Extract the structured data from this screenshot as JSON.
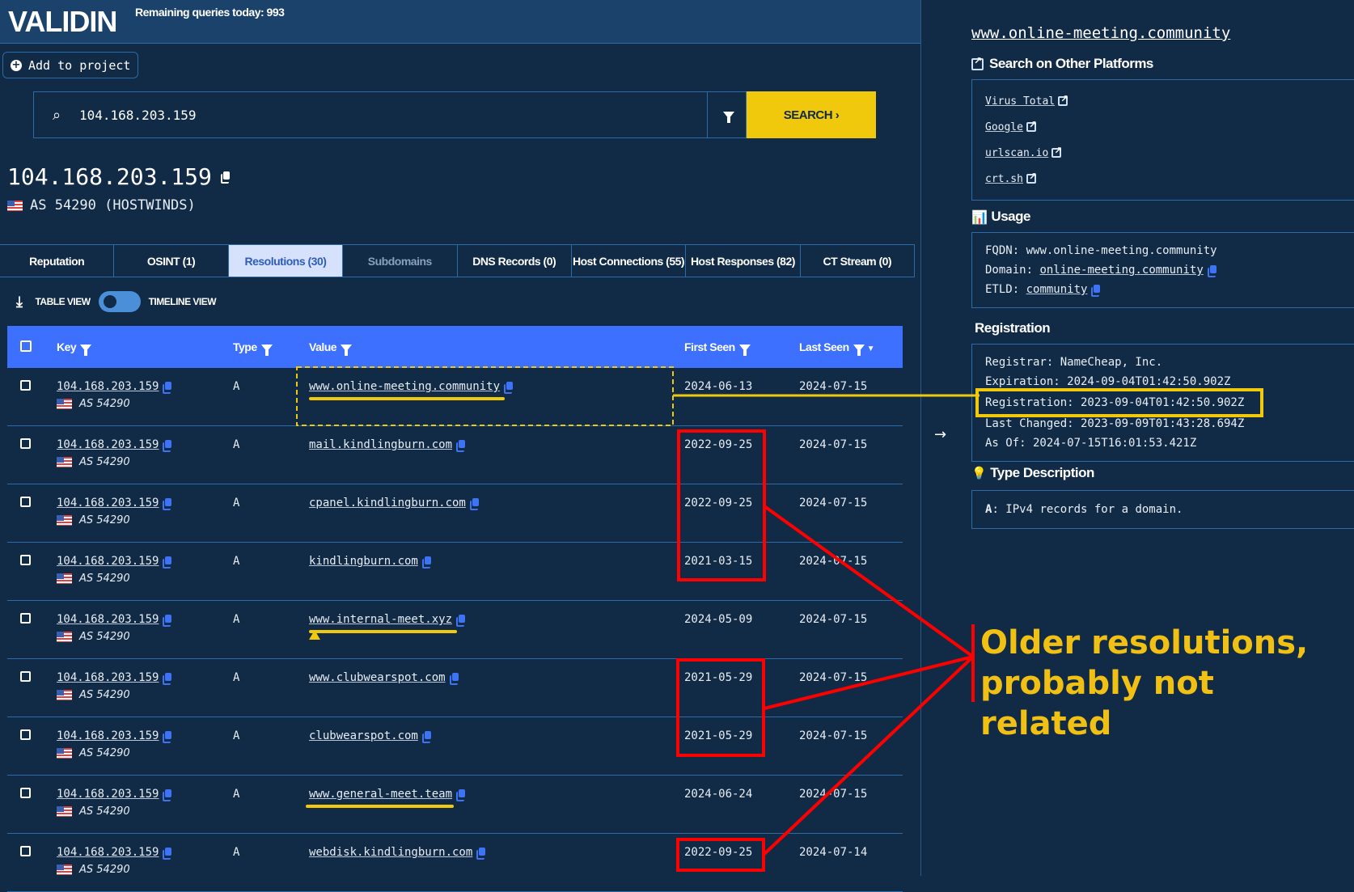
{
  "header": {
    "logo": "VALIDIN",
    "remaining": "Remaining queries today: 993"
  },
  "actions": {
    "add_to_project": "Add to project"
  },
  "search": {
    "value": "104.168.203.159",
    "placeholder": "",
    "button": "SEARCH ›"
  },
  "subject": {
    "ip": "104.168.203.159",
    "asn": "AS 54290 (HOSTWINDS)"
  },
  "tabs": [
    {
      "label": "Reputation"
    },
    {
      "label": "OSINT (1)"
    },
    {
      "label": "Resolutions (30)"
    },
    {
      "label": "Subdomains"
    },
    {
      "label": "DNS Records (0)"
    },
    {
      "label": "Host Connections (55)"
    },
    {
      "label": "Host Responses (82)"
    },
    {
      "label": "CT Stream (0)"
    }
  ],
  "view": {
    "table": "TABLE VIEW",
    "timeline": "TIMELINE VIEW"
  },
  "table": {
    "headers": {
      "key": "Key",
      "type": "Type",
      "value": "Value",
      "first": "First Seen",
      "last": "Last Seen"
    },
    "rows": [
      {
        "key": "104.168.203.159",
        "asn": "AS 54290",
        "type": "A",
        "value": "www.online-meeting.community",
        "first": "2024-06-13",
        "last": "2024-07-15"
      },
      {
        "key": "104.168.203.159",
        "asn": "AS 54290",
        "type": "A",
        "value": "mail.kindlingburn.com",
        "first": "2022-09-25",
        "last": "2024-07-15"
      },
      {
        "key": "104.168.203.159",
        "asn": "AS 54290",
        "type": "A",
        "value": "cpanel.kindlingburn.com",
        "first": "2022-09-25",
        "last": "2024-07-15"
      },
      {
        "key": "104.168.203.159",
        "asn": "AS 54290",
        "type": "A",
        "value": "kindlingburn.com",
        "first": "2021-03-15",
        "last": "2024-07-15"
      },
      {
        "key": "104.168.203.159",
        "asn": "AS 54290",
        "type": "A",
        "value": "www.internal-meet.xyz",
        "first": "2024-05-09",
        "last": "2024-07-15"
      },
      {
        "key": "104.168.203.159",
        "asn": "AS 54290",
        "type": "A",
        "value": "www.clubwearspot.com",
        "first": "2021-05-29",
        "last": "2024-07-15"
      },
      {
        "key": "104.168.203.159",
        "asn": "AS 54290",
        "type": "A",
        "value": "clubwearspot.com",
        "first": "2021-05-29",
        "last": "2024-07-15"
      },
      {
        "key": "104.168.203.159",
        "asn": "AS 54290",
        "type": "A",
        "value": "www.general-meet.team",
        "first": "2024-06-24",
        "last": "2024-07-15"
      },
      {
        "key": "104.168.203.159",
        "asn": "AS 54290",
        "type": "A",
        "value": "webdisk.kindlingburn.com",
        "first": "2022-09-25",
        "last": "2024-07-14"
      }
    ]
  },
  "side": {
    "title": "www.online-meeting.community",
    "platforms": {
      "heading": "Search on Other Platforms",
      "links": [
        "Virus Total",
        "Google",
        "urlscan.io",
        "crt.sh"
      ]
    },
    "usage": {
      "heading": "Usage",
      "fqdn_label": "FQDN:",
      "fqdn": "www.online-meeting.community",
      "domain_label": "Domain:",
      "domain": "online-meeting.community",
      "etld_label": "ETLD:",
      "etld": "community"
    },
    "registration": {
      "heading": "Registration",
      "registrar": "Registrar: NameCheap, Inc.",
      "expiration": "Expiration: 2024-09-04T01:42:50.902Z",
      "registration": "Registration: 2023-09-04T01:42:50.902Z",
      "last_changed": "Last Changed: 2023-09-09T01:43:28.694Z",
      "as_of": "As Of: 2024-07-15T16:01:53.421Z"
    },
    "type_desc": {
      "heading": "Type Description",
      "type": "A",
      "text": ": IPv4 records for a domain."
    }
  },
  "annotation": {
    "line1": "Older resolutions,",
    "line2": "probably not related",
    "highlight_color": "#f0c80c",
    "mark_color": "#ff0000"
  }
}
